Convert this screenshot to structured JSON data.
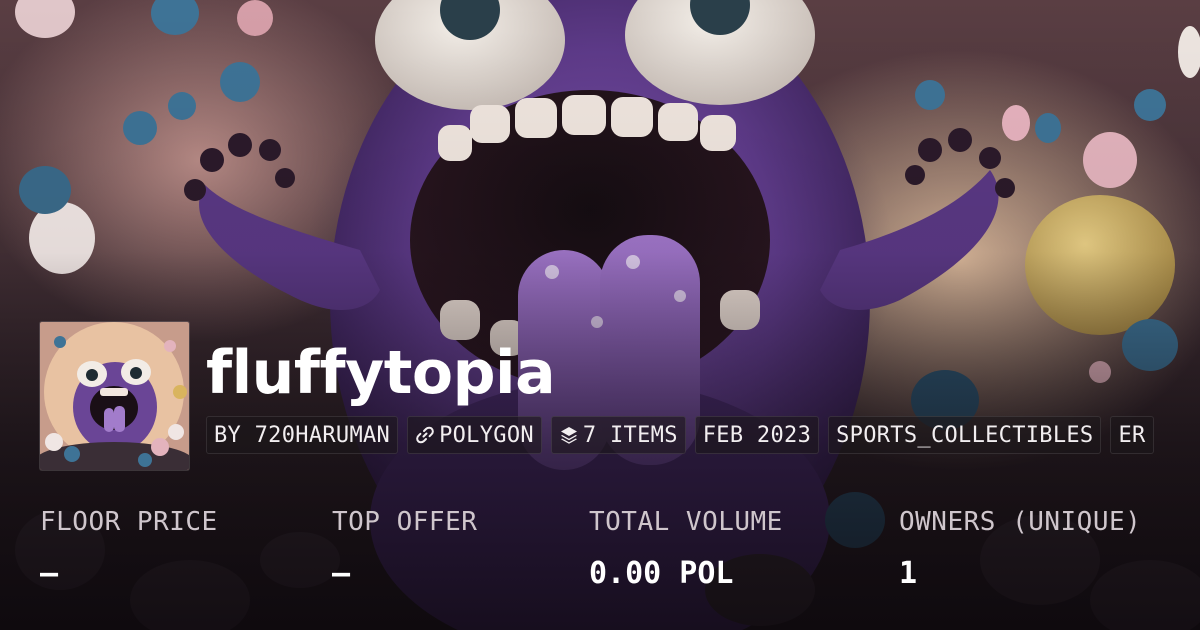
{
  "collection": {
    "name": "fluffytopia",
    "avatar_alt": "fluffytopia collection avatar",
    "tags": [
      {
        "label": "BY 720HARUMAN",
        "icon": ""
      },
      {
        "label": "POLYGON",
        "icon": "chain-link-icon"
      },
      {
        "label": "7 ITEMS",
        "icon": "layers-icon"
      },
      {
        "label": "FEB 2023",
        "icon": ""
      },
      {
        "label": "SPORTS_COLLECTIBLES",
        "icon": ""
      },
      {
        "label": "ER",
        "icon": ""
      }
    ]
  },
  "stats": [
    {
      "label": "FLOOR PRICE",
      "value": "–"
    },
    {
      "label": "TOP OFFER",
      "value": "–"
    },
    {
      "label": "TOTAL VOLUME",
      "value": "0.00 POL"
    },
    {
      "label": "OWNERS (UNIQUE)",
      "value": "1"
    }
  ],
  "colors": {
    "monster_purple": "#6a4596",
    "text_primary": "#ffffff",
    "text_secondary": "#cfc6cc"
  }
}
